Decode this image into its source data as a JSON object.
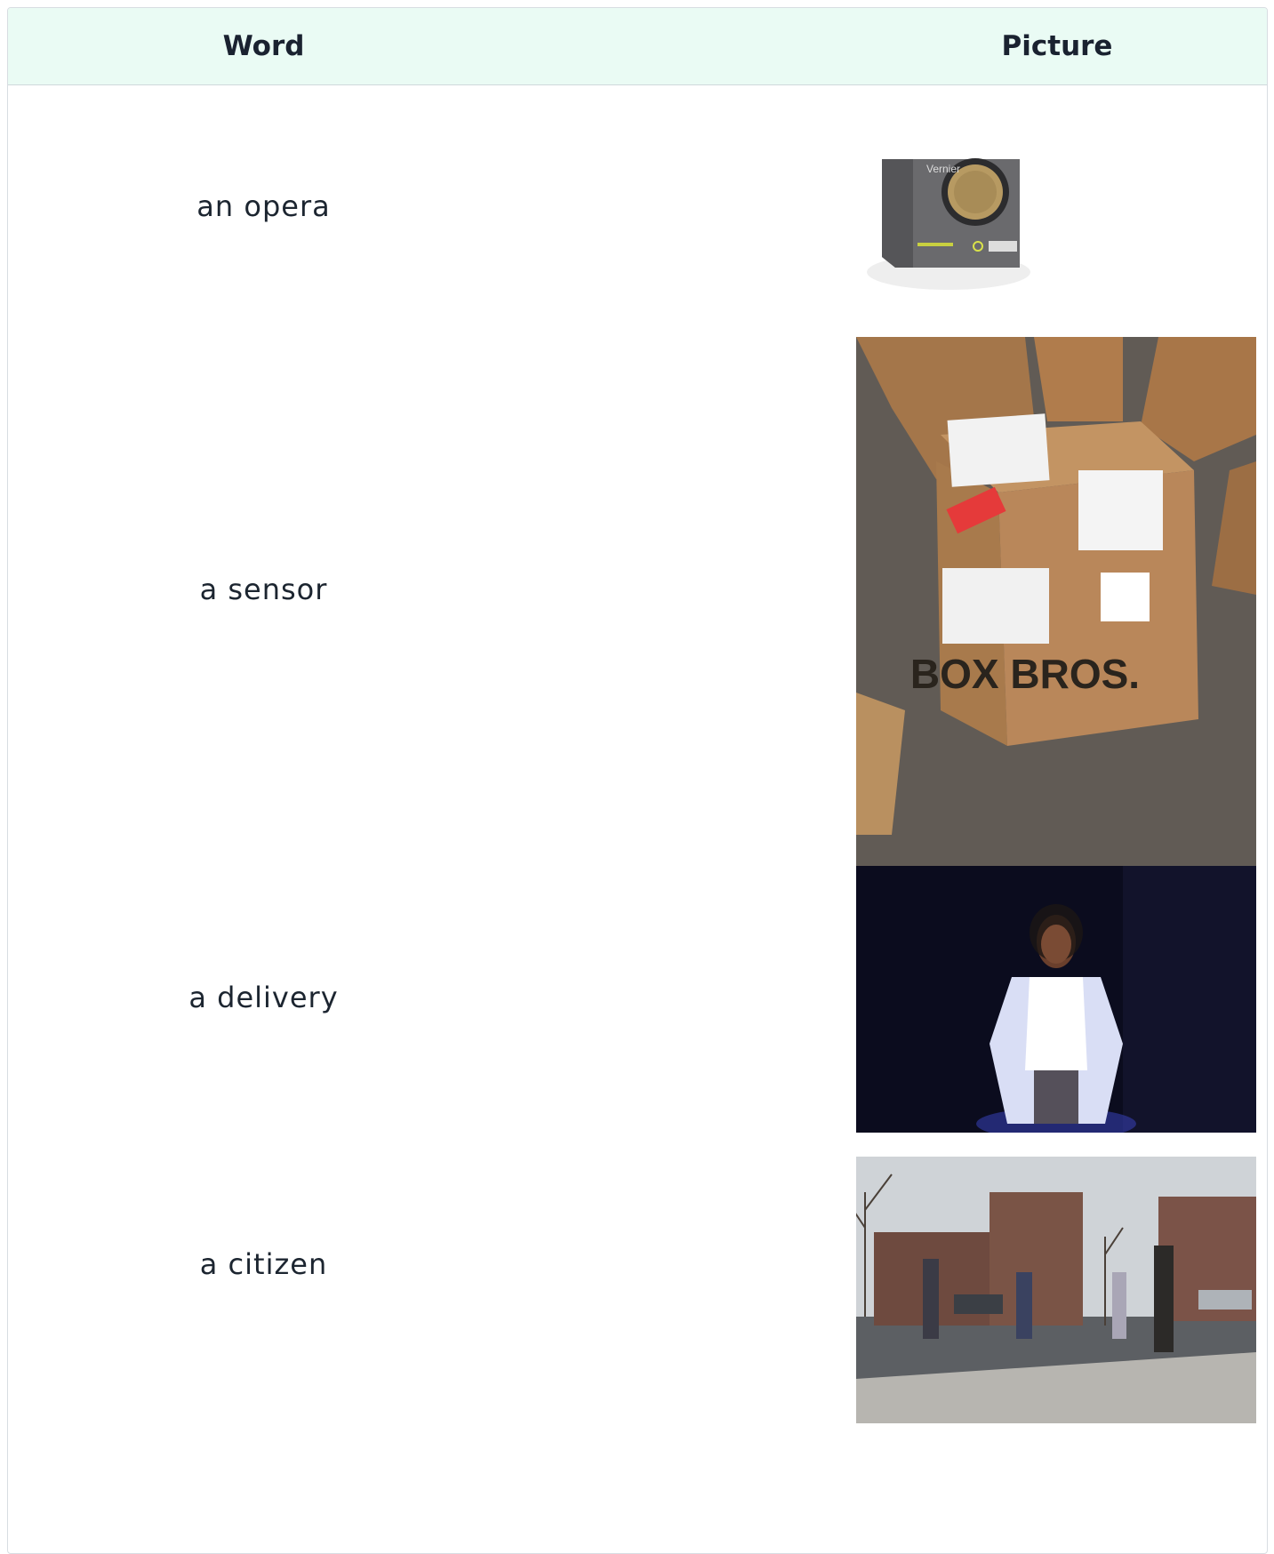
{
  "table": {
    "headers": {
      "word": "Word",
      "picture": "Picture"
    },
    "rows": [
      {
        "word": "an opera",
        "picture": "motion-sensor-device-photo",
        "picture_text": "Vernier"
      },
      {
        "word": "a sensor",
        "picture": "cardboard-box-delivery-photo",
        "picture_text": "BOX BROS."
      },
      {
        "word": "a delivery",
        "picture": "opera-singer-on-stage-photo"
      },
      {
        "word": "a citizen",
        "picture": "people-on-street-photo"
      }
    ]
  },
  "colors": {
    "header_bg": "#eafbf4",
    "border": "#d8dde2",
    "text": "#1c2530"
  }
}
